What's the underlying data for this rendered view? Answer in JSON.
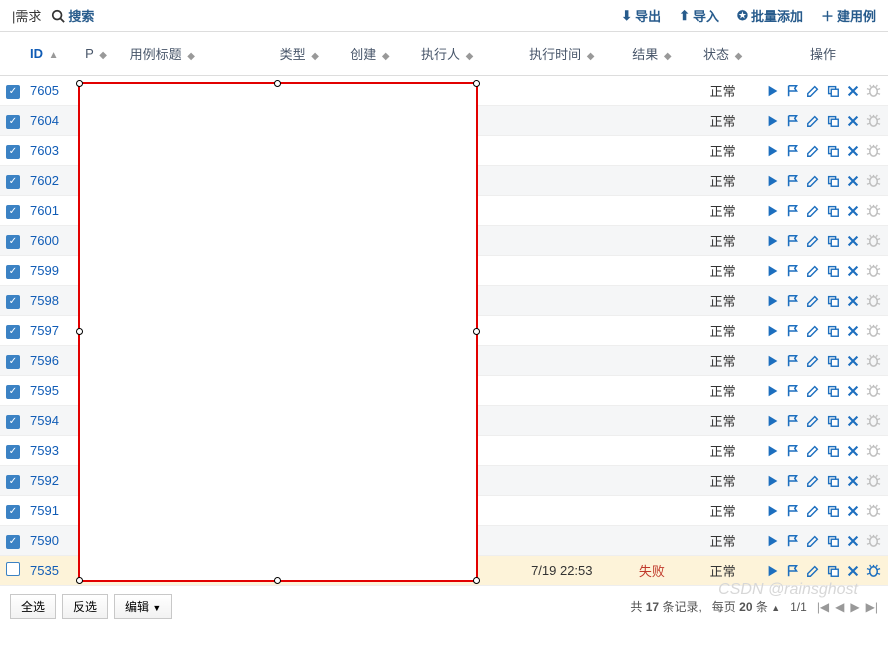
{
  "topbar": {
    "left_label": "|需求",
    "search_label": "搜索",
    "export": "导出",
    "import": "导入",
    "batch_add": "批量添加",
    "create": "建用例"
  },
  "columns": {
    "id": "ID",
    "p": "P",
    "title": "用例标题",
    "type": "类型",
    "creator": "创建",
    "executor": "执行人",
    "exec_time": "执行时间",
    "result": "结果",
    "status": "状态",
    "ops": "操作"
  },
  "status_normal": "正常",
  "result_fail": "失败",
  "rows": [
    {
      "id": "7605",
      "checked": true,
      "exec_time": "",
      "result": "",
      "status": "正常",
      "bug": false
    },
    {
      "id": "7604",
      "checked": true,
      "exec_time": "",
      "result": "",
      "status": "正常",
      "bug": false
    },
    {
      "id": "7603",
      "checked": true,
      "exec_time": "",
      "result": "",
      "status": "正常",
      "bug": false
    },
    {
      "id": "7602",
      "checked": true,
      "exec_time": "",
      "result": "",
      "status": "正常",
      "bug": false
    },
    {
      "id": "7601",
      "checked": true,
      "exec_time": "",
      "result": "",
      "status": "正常",
      "bug": false
    },
    {
      "id": "7600",
      "checked": true,
      "exec_time": "",
      "result": "",
      "status": "正常",
      "bug": false
    },
    {
      "id": "7599",
      "checked": true,
      "exec_time": "",
      "result": "",
      "status": "正常",
      "bug": false
    },
    {
      "id": "7598",
      "checked": true,
      "exec_time": "",
      "result": "",
      "status": "正常",
      "bug": false
    },
    {
      "id": "7597",
      "checked": true,
      "exec_time": "",
      "result": "",
      "status": "正常",
      "bug": false
    },
    {
      "id": "7596",
      "checked": true,
      "exec_time": "",
      "result": "",
      "status": "正常",
      "bug": false
    },
    {
      "id": "7595",
      "checked": true,
      "exec_time": "",
      "result": "",
      "status": "正常",
      "bug": false
    },
    {
      "id": "7594",
      "checked": true,
      "exec_time": "",
      "result": "",
      "status": "正常",
      "bug": false
    },
    {
      "id": "7593",
      "checked": true,
      "exec_time": "",
      "result": "",
      "status": "正常",
      "bug": false
    },
    {
      "id": "7592",
      "checked": true,
      "exec_time": "",
      "result": "",
      "status": "正常",
      "bug": false
    },
    {
      "id": "7591",
      "checked": true,
      "exec_time": "",
      "result": "",
      "status": "正常",
      "bug": false
    },
    {
      "id": "7590",
      "checked": true,
      "exec_time": "",
      "result": "",
      "status": "正常",
      "bug": false
    },
    {
      "id": "7535",
      "checked": false,
      "exec_time": "7/19 22:53",
      "result": "失败",
      "status": "正常",
      "bug": true
    }
  ],
  "footer": {
    "select_all": "全选",
    "invert": "反选",
    "edit": "编辑",
    "total_prefix": "共",
    "total_count": "17",
    "total_suffix": "条记录,",
    "per_page_prefix": "每页",
    "per_page_value": "20",
    "per_page_suffix": "条",
    "page_info": "1/1"
  },
  "watermark": "CSDN @rainsghost"
}
